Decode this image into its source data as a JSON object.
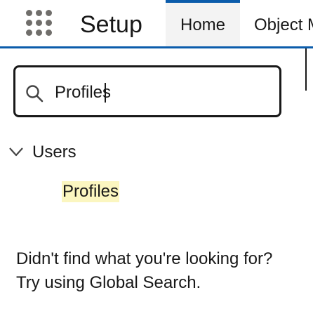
{
  "header": {
    "app_title": "Setup",
    "tabs": [
      {
        "label": "Home",
        "active": true
      },
      {
        "label": "Object M",
        "active": false
      }
    ],
    "accent": "#0b5cab"
  },
  "search": {
    "value": "Profiles",
    "placeholder": "",
    "icon": "search-icon"
  },
  "results": {
    "group_label": "Users",
    "group_icon": "chevron-down-icon",
    "items": [
      {
        "label": "Profiles",
        "highlight": "#fbf6c0"
      }
    ]
  },
  "not_found": {
    "line1": "Didn't find what you're looking for?",
    "line2": "Try using Global Search."
  }
}
